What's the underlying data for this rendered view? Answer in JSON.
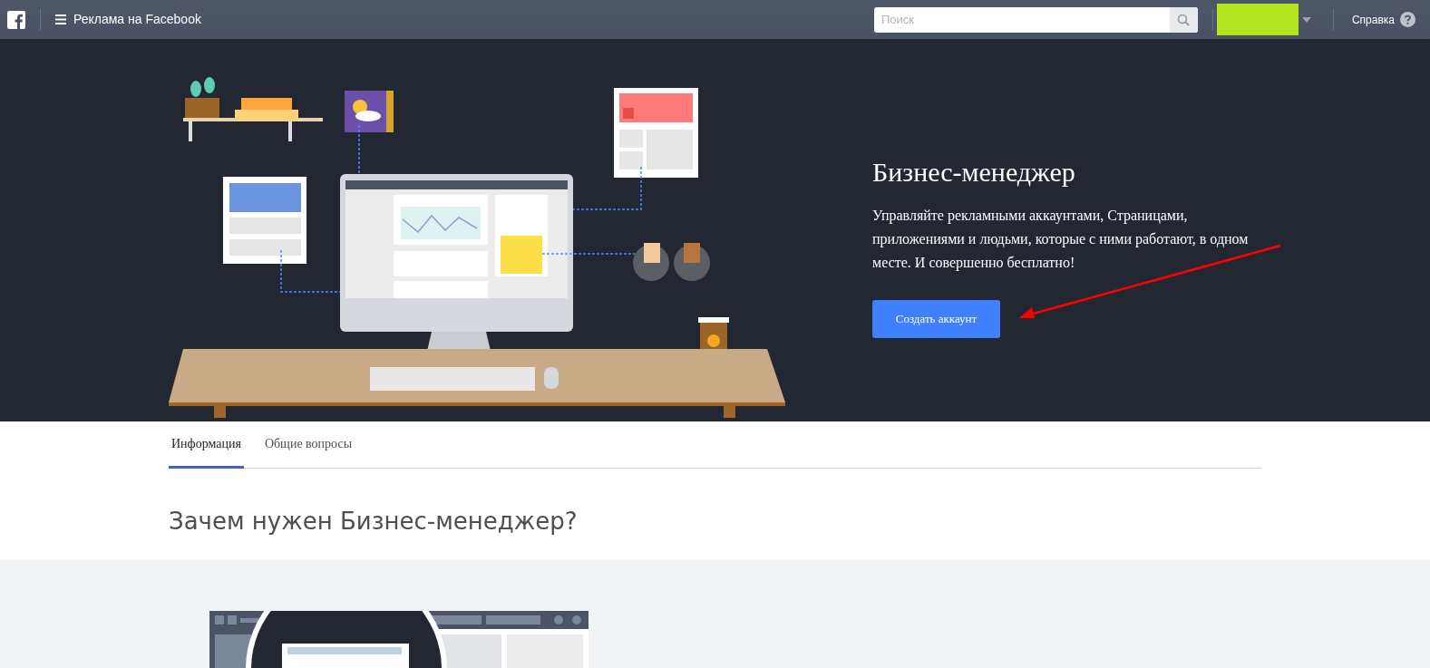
{
  "top_bar": {
    "title": "Реклама на Facebook",
    "search": {
      "placeholder": "Поиск"
    },
    "help": "Справка"
  },
  "hero": {
    "title": "Бизнес-менеджер",
    "description": "Управляйте рекламными аккаунтами, Страницами, приложениями и людьми, которые с ними работают, в одном месте. И совершенно бесплатно!",
    "button": "Создать аккаунт"
  },
  "tabs": [
    {
      "label": "Информация",
      "selected": true
    },
    {
      "label": "Общие вопросы",
      "selected": false
    }
  ],
  "section": {
    "heading": "Зачем нужен Бизнес-менеджер?"
  }
}
